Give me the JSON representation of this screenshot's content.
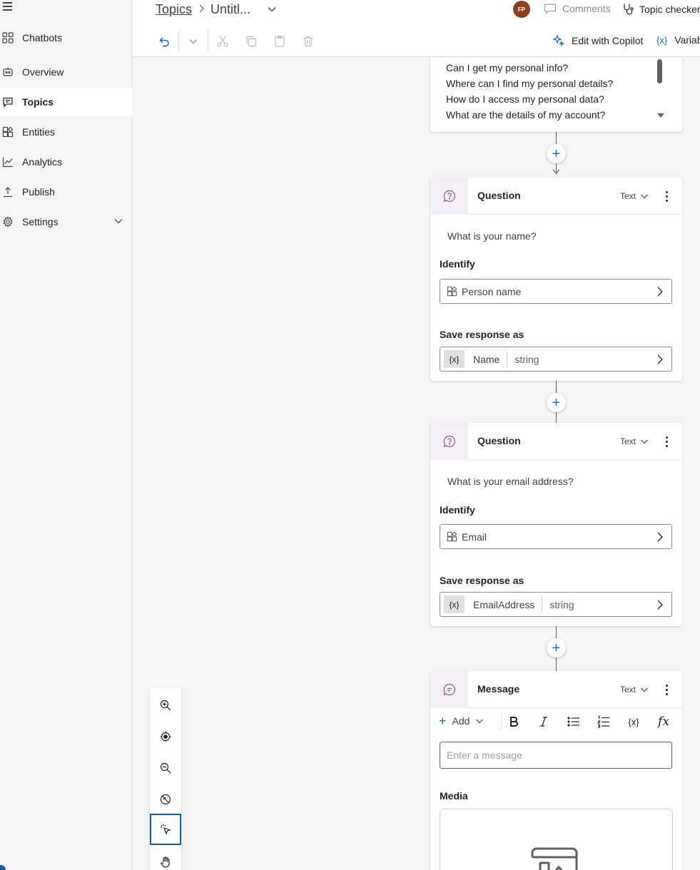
{
  "sidebar": {
    "items": [
      {
        "label": "Chatbots",
        "icon": "grid-icon"
      },
      {
        "label": "Overview",
        "icon": "bot-icon"
      },
      {
        "label": "Topics",
        "icon": "chat-icon",
        "active": true
      },
      {
        "label": "Entities",
        "icon": "entities-icon"
      },
      {
        "label": "Analytics",
        "icon": "analytics-icon"
      },
      {
        "label": "Publish",
        "icon": "publish-icon"
      },
      {
        "label": "Settings",
        "icon": "gear-icon"
      }
    ]
  },
  "header": {
    "breadcrumb_link": "Topics",
    "breadcrumb_current": "Untitl...",
    "avatar_initials": "FP",
    "comments_label": "Comments",
    "topic_checker_label": "Topic checker"
  },
  "toolbar": {
    "copilot_label": "Edit with Copilot",
    "variables_icon_text": "{x}",
    "variables_label": "Variab"
  },
  "trigger": {
    "phrases": [
      "Can I get my personal info?",
      "Where can I find my personal details?",
      "How do I access my personal data?",
      "What are the details of my account?"
    ]
  },
  "nodes": {
    "q1": {
      "title": "Question",
      "type": "Text",
      "question": "What is your name?",
      "identify_label": "Identify",
      "entity": "Person name",
      "save_label": "Save response as",
      "var_icon": "{x}",
      "var_name": "Name",
      "var_type": "string"
    },
    "q2": {
      "title": "Question",
      "type": "Text",
      "question": "What is your email address?",
      "identify_label": "Identify",
      "entity": "Email",
      "save_label": "Save response as",
      "var_icon": "{x}",
      "var_name": "EmailAddress",
      "var_type": "string"
    },
    "message": {
      "title": "Message",
      "type": "Text",
      "add_label": "Add",
      "variable_btn": "{x}",
      "formula_btn": "fx",
      "placeholder": "Enter a message",
      "media_label": "Media"
    }
  },
  "colors": {
    "accent": "#0f6cbd",
    "node_icon_bg": "#f4eef6",
    "node_icon": "#8f5a9b",
    "avatar": "#8e3e1e"
  }
}
